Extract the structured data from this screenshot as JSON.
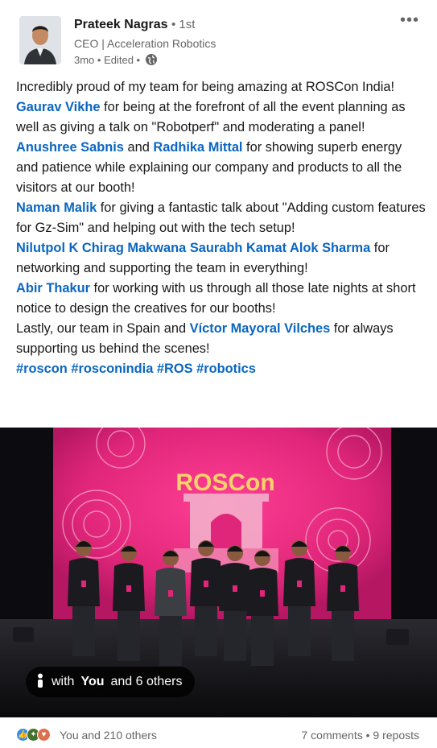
{
  "author": {
    "name": "Prateek Nagras",
    "degree": "• 1st",
    "title": "CEO | Acceleration Robotics",
    "time": "3mo • Edited •"
  },
  "post": {
    "line1": "Incredibly proud of my team for being amazing at ROSCon India!",
    "m_gaurav": "Gaurav Vikhe",
    "t_gaurav": " for being at the forefront of all the event planning as well as giving a talk on \"Robotperf\" and moderating a panel!",
    "m_anushree": "Anushree Sabnis",
    "t_and": " and ",
    "m_radhika": "Radhika Mittal",
    "t_radhika": " for showing superb energy and patience while explaining our company and products to all the visitors at our booth!",
    "m_naman": "Naman Malik",
    "t_naman": " for giving a fantastic talk about \"Adding custom features for Gz-Sim\" and helping out with the tech setup!",
    "m_group": "Nilutpol K Chirag Makwana Saurabh Kamat Alok Sharma",
    "t_group": " for networking and supporting the team in everything!",
    "m_abir": "Abir Thakur",
    "t_abir": " for working with us through all those late nights at short notice to design the creatives for our booths!",
    "t_lastly": "Lastly, our team in Spain and ",
    "m_victor": "Víctor Mayoral Vilches",
    "t_victor": " for always supporting us behind the scenes!",
    "hashtags": [
      "#roscon",
      "#rosconindia",
      "#ROS",
      "#robotics"
    ]
  },
  "photo": {
    "banner_text": "ROSCon",
    "tag_prefix": "with",
    "tag_you": "You",
    "tag_suffix": "and 6 others"
  },
  "footer": {
    "reactions": "You and 210 others",
    "stats": "7 comments • 9 reposts"
  },
  "colors": {
    "link": "#0a66c2",
    "banner_pink": "#e0267a",
    "muted": "#666666"
  }
}
